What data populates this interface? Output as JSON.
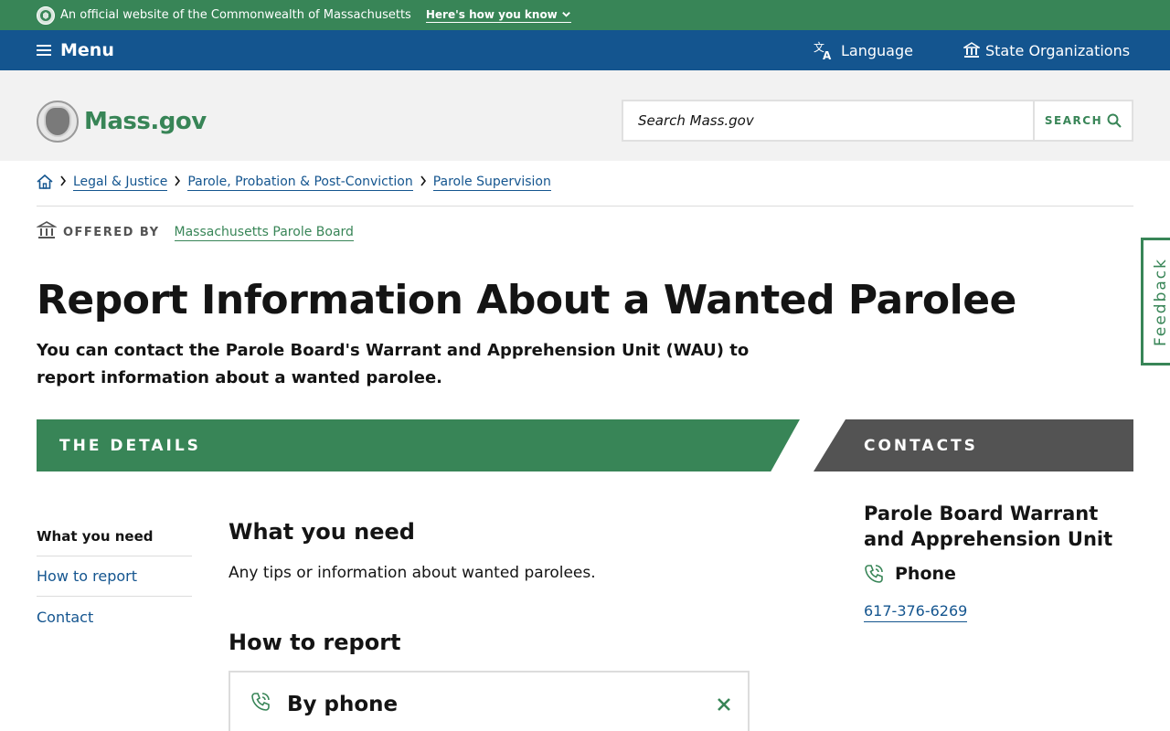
{
  "official_banner": {
    "text": "An official website of the Commonwealth of Massachusetts",
    "how_link": "Here's how you know"
  },
  "utility_nav": {
    "menu": "Menu",
    "language": "Language",
    "state_orgs": "State Organizations"
  },
  "header": {
    "logo_text": "Mass.gov",
    "search_placeholder": "Search Mass.gov",
    "search_button": "SEARCH"
  },
  "breadcrumb": [
    "Legal & Justice",
    "Parole, Probation & Post-Conviction",
    "Parole Supervision"
  ],
  "offered_by": {
    "label": "OFFERED BY",
    "org": "Massachusetts Parole Board"
  },
  "feedback": "Feedback",
  "page": {
    "title": "Report Information About a Wanted Parolee",
    "lede": "You can contact the Parole Board's Warrant and Apprehension Unit (WAU) to report information about a wanted parolee."
  },
  "bands": {
    "details": "THE DETAILS",
    "contacts": "CONTACTS"
  },
  "left_nav": [
    "What you need",
    "How to report",
    "Contact"
  ],
  "content": {
    "what_you_need_heading": "What you need",
    "what_you_need_text": "Any tips or information about wanted parolees.",
    "how_to_report_heading": "How to report",
    "accordion_label": "By phone"
  },
  "contact": {
    "name": "Parole Board Warrant and Apprehension Unit",
    "phone_label": "Phone",
    "phone_number": "617-376-6269"
  },
  "colors": {
    "green": "#388557",
    "blue": "#14558f",
    "dark_gray": "#535353",
    "header_bg": "#f2f2f2"
  }
}
